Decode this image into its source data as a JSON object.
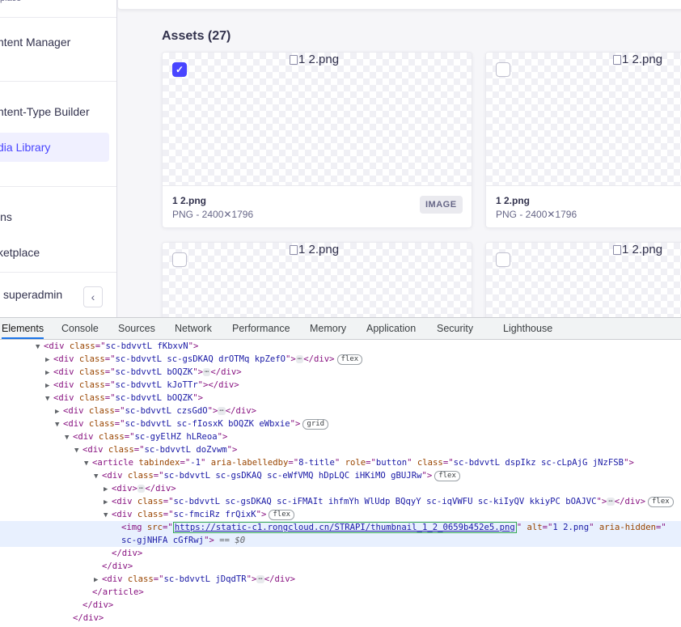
{
  "sidebar": {
    "top_partial": "place",
    "items": [
      {
        "label": "ntent Manager",
        "active": false
      },
      {
        "label": "ntent-Type Builder",
        "active": false
      },
      {
        "label": "dia Library",
        "active": true
      },
      {
        "label": "ins",
        "active": false
      },
      {
        "label": "ketplace",
        "active": false
      }
    ],
    "user": "superadmin",
    "collapse_icon": "chevron-left-icon"
  },
  "main": {
    "assets_title": "Assets (27)",
    "cards": [
      {
        "alt": "1 2.png",
        "name": "1 2.png",
        "meta": "PNG - 2400✕1796",
        "badge": "IMAGE",
        "checked": true
      },
      {
        "alt": "1 2.png",
        "name": "1 2.png",
        "meta": "PNG - 2400✕1796",
        "badge": "",
        "checked": false
      },
      {
        "alt": "1 2.png",
        "name": "",
        "meta": "",
        "badge": "",
        "checked": false
      },
      {
        "alt": "1 2.png",
        "name": "",
        "meta": "",
        "badge": "",
        "checked": false
      }
    ]
  },
  "devtools": {
    "tabs": [
      "Elements",
      "Console",
      "Sources",
      "Network",
      "Performance",
      "Memory",
      "Application",
      "Security",
      "Lighthouse"
    ],
    "active_tab": "Elements",
    "src_url": "https://static-c1.rongcloud.cn/STRAPI/thumbnail_1_2_0659b452e5.png",
    "selected_marker": "== $0",
    "badges": {
      "flex": "flex",
      "grid": "grid"
    },
    "ellipsis": "⋯"
  },
  "colors": {
    "accent": "#4945ff",
    "active_bg": "#f0f0ff",
    "devtools_selected": "#e8f0fe"
  }
}
